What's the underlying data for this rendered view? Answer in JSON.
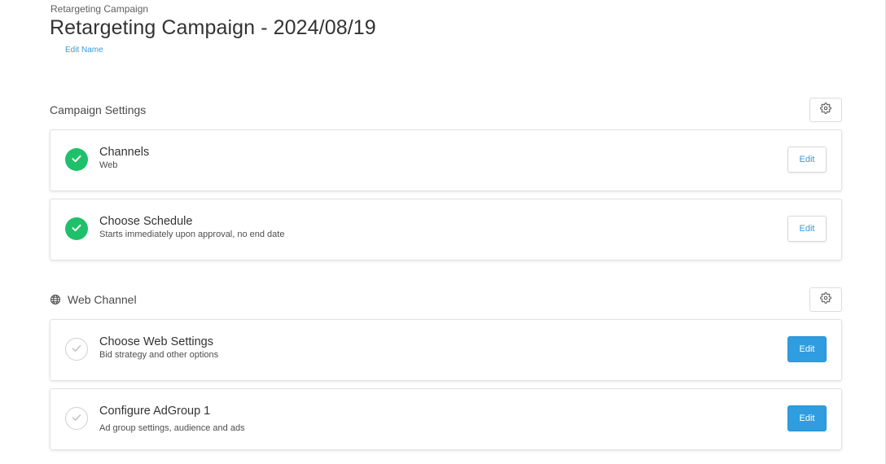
{
  "breadcrumb": "Retargeting Campaign",
  "page_title": "Retargeting Campaign - 2024/08/19",
  "edit_name_label": "Edit Name",
  "sections": [
    {
      "title": "Campaign Settings",
      "icon": "",
      "cards": [
        {
          "title": "Channels",
          "subtitle": "Web",
          "status": "complete",
          "edit_label": "Edit"
        },
        {
          "title": "Choose Schedule",
          "subtitle": "Starts immediately upon approval, no end date",
          "status": "complete",
          "edit_label": "Edit"
        }
      ]
    },
    {
      "title": "Web Channel",
      "icon": "globe-icon",
      "cards": [
        {
          "title": "Choose Web Settings",
          "subtitle": "Bid strategy and other options",
          "status": "incomplete",
          "edit_label": "Edit"
        },
        {
          "title": "Configure AdGroup 1",
          "subtitle": "Ad group settings, audience and ads",
          "status": "incomplete",
          "edit_label": "Edit"
        }
      ]
    }
  ],
  "colors": {
    "accent": "#2f9ddf",
    "link": "#3a9ad9",
    "success": "#1fc06a"
  }
}
